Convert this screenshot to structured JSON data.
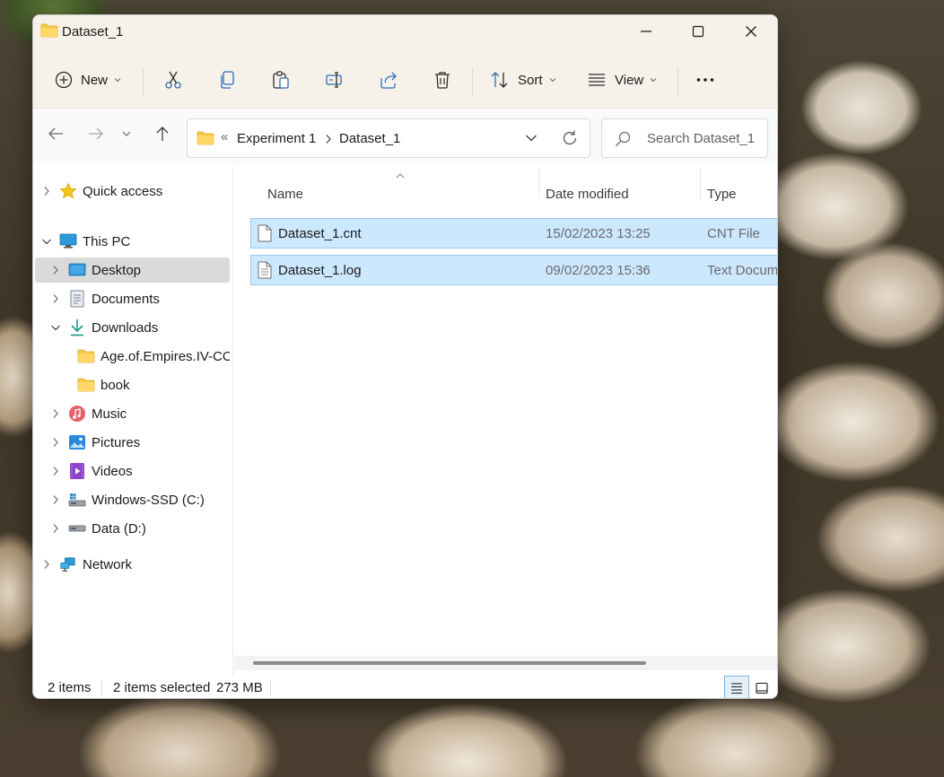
{
  "window": {
    "title": "Dataset_1"
  },
  "toolbar": {
    "new_label": "New",
    "sort_label": "Sort",
    "view_label": "View",
    "icons": [
      "new-icon",
      "cut-icon",
      "copy-icon",
      "paste-icon",
      "rename-icon",
      "share-icon",
      "delete-icon",
      "sort-icon",
      "view-icon",
      "more-icon"
    ]
  },
  "address": {
    "overflow": "«",
    "crumbs": [
      "Experiment 1",
      "Dataset_1"
    ]
  },
  "search": {
    "placeholder": "Search Dataset_1"
  },
  "sidebar": {
    "items": [
      {
        "label": "Quick access",
        "icon": "star-icon"
      },
      {
        "label": "This PC",
        "icon": "monitor-icon"
      },
      {
        "label": "Desktop",
        "icon": "desktop-icon",
        "selected": true
      },
      {
        "label": "Documents",
        "icon": "documents-icon"
      },
      {
        "label": "Downloads",
        "icon": "download-icon"
      },
      {
        "label": "Age.of.Empires.IV-COI",
        "icon": "folder-icon"
      },
      {
        "label": "book",
        "icon": "folder-icon"
      },
      {
        "label": "Music",
        "icon": "music-icon"
      },
      {
        "label": "Pictures",
        "icon": "pictures-icon"
      },
      {
        "label": "Videos",
        "icon": "videos-icon"
      },
      {
        "label": "Windows-SSD (C:)",
        "icon": "drive-c-icon"
      },
      {
        "label": "Data (D:)",
        "icon": "drive-d-icon"
      },
      {
        "label": "Network",
        "icon": "network-icon"
      }
    ]
  },
  "columns": {
    "name": "Name",
    "date": "Date modified",
    "type": "Type"
  },
  "files": [
    {
      "name": "Dataset_1.cnt",
      "date": "15/02/2023 13:25",
      "type": "CNT File"
    },
    {
      "name": "Dataset_1.log",
      "date": "09/02/2023 15:36",
      "type": "Text Docum"
    }
  ],
  "status": {
    "count": "2 items",
    "selected": "2 items selected",
    "size": "273 MB"
  },
  "colors": {
    "selection": "#cce8ff",
    "selection_border": "#99c9ef",
    "folder": "#f7c94b",
    "accent": "#0067c0"
  }
}
